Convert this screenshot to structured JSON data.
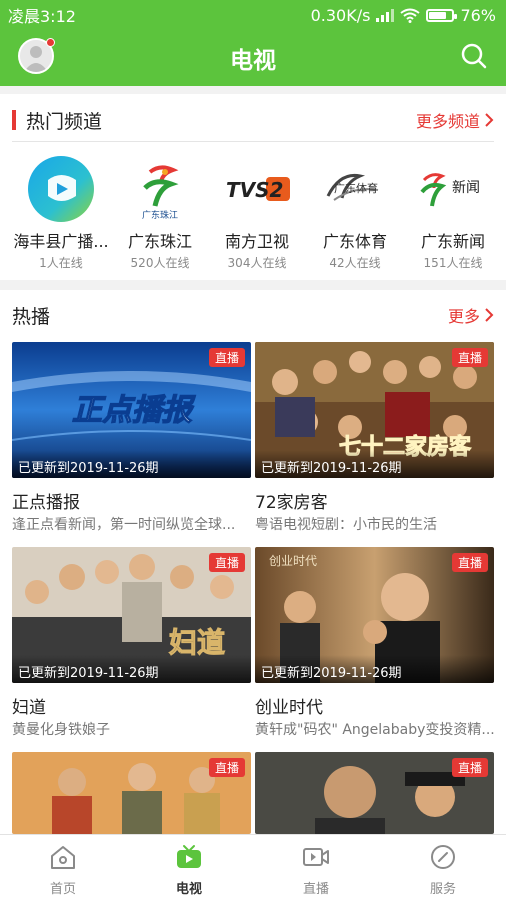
{
  "status_bar": {
    "time": "凌晨3:12",
    "network_speed": "0.30K/s",
    "battery": "76%",
    "battery_level": 0.76
  },
  "header": {
    "title": "电视"
  },
  "hot_channels": {
    "title": "热门频道",
    "more_label": "更多频道",
    "items": [
      {
        "name": "海丰县广播...",
        "count": "1人在线",
        "icon": "circle-play-logo"
      },
      {
        "name": "广东珠江",
        "count": "520人在线",
        "icon": "gd-pearl-logo",
        "logo_text": "广东珠江"
      },
      {
        "name": "南方卫视",
        "count": "304人在线",
        "icon": "tvs2-logo",
        "logo_text": "TVS2"
      },
      {
        "name": "广东体育",
        "count": "42人在线",
        "icon": "gd-sports-logo",
        "logo_text": "广东体育"
      },
      {
        "name": "广东新闻",
        "count": "151人在线",
        "icon": "gd-news-logo",
        "logo_text": "新闻"
      }
    ]
  },
  "hot_play": {
    "title": "热播",
    "more_label": "更多",
    "items": [
      {
        "title": "正点播报",
        "desc": "逢正点看新闻，第一时间纵览全球...",
        "badge": "直播",
        "update": "已更新到2019-11-26期",
        "overlay": "正点播报"
      },
      {
        "title": "72家房客",
        "desc": "粤语电视短剧：小市民的生活",
        "badge": "直播",
        "update": "已更新到2019-11-26期",
        "overlay": "七十二家房客"
      },
      {
        "title": "妇道",
        "desc": "黄曼化身铁娘子",
        "badge": "直播",
        "update": "已更新到2019-11-26期",
        "overlay": "妇道"
      },
      {
        "title": "创业时代",
        "desc": "黄轩成\"码农\" Angelababy变投资精...",
        "badge": "直播",
        "update": "已更新到2019-11-26期",
        "overlay": "创业时代"
      },
      {
        "title": "",
        "desc": "",
        "badge": "直播",
        "update": ""
      },
      {
        "title": "",
        "desc": "",
        "badge": "直播",
        "update": ""
      }
    ]
  },
  "tabs": [
    {
      "label": "首页",
      "icon": "home-icon"
    },
    {
      "label": "电视",
      "icon": "tv-icon",
      "active": true
    },
    {
      "label": "直播",
      "icon": "video-icon"
    },
    {
      "label": "服务",
      "icon": "compass-icon"
    }
  ],
  "colors": {
    "brand_green": "#5cc43d",
    "accent_red": "#e53935"
  }
}
